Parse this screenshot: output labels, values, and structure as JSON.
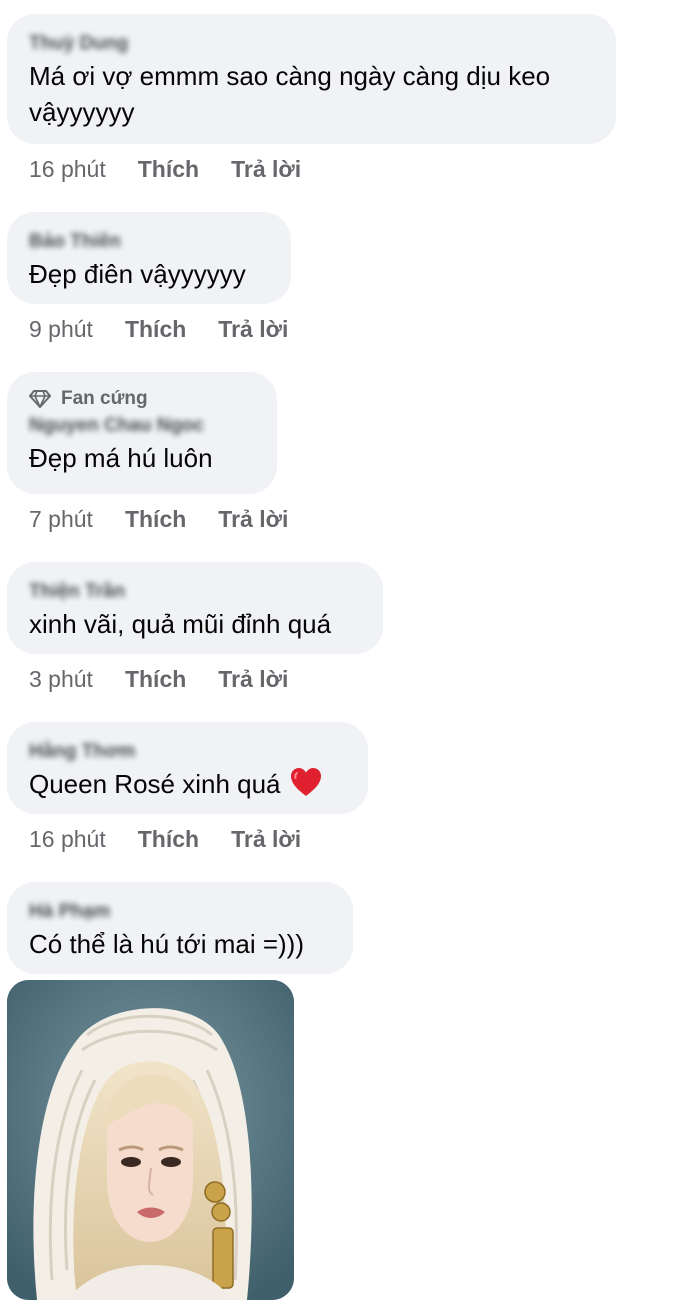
{
  "comments": [
    {
      "name": "Thuỳ Dung",
      "text": "Má ơi vợ emmm sao càng ngày càng dịu keo vậyyyyyy",
      "time": "16 phút",
      "like": "Thích",
      "reply": "Trả lời"
    },
    {
      "name": "Bảo Thiên",
      "text": "Đẹp điên vậyyyyyy",
      "time": "9 phút",
      "like": "Thích",
      "reply": "Trả lời"
    },
    {
      "badge": "Fan cứng",
      "name": "Nguyen Chau Ngoc",
      "text": "Đẹp má hú luôn",
      "time": "7 phút",
      "like": "Thích",
      "reply": "Trả lời"
    },
    {
      "name": "Thiện Trần",
      "text": "xinh vãi, quả mũi đỉnh quá",
      "time": "3 phút",
      "like": "Thích",
      "reply": "Trả lời"
    },
    {
      "name": "Hằng Thơm",
      "text": "Queen Rosé xinh quá",
      "emoji": "red-heart-icon",
      "time": "16 phút",
      "like": "Thích",
      "reply": "Trả lời"
    },
    {
      "name": "Hà Phạm",
      "text": "Có thể là hú tới mai =)))",
      "image": "woman-portrait-photo"
    }
  ],
  "colors": {
    "bubble": "#f0f2f5",
    "meta_text": "#65676b",
    "primary_text": "#050505",
    "heart": "#e0202e"
  }
}
